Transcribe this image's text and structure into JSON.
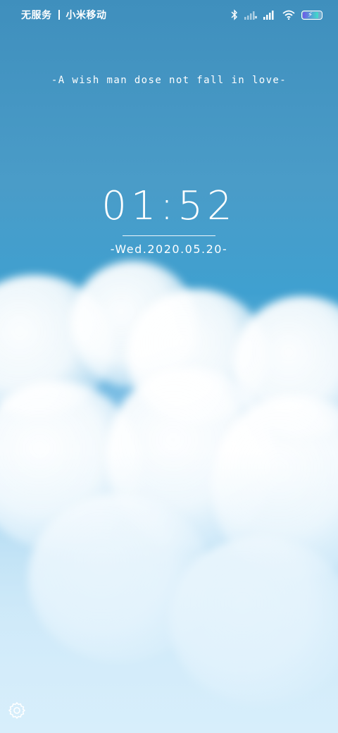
{
  "status_bar": {
    "carrier_1": "无服务",
    "carrier_2": "小米移动",
    "battery_level": 0.85,
    "icons": [
      "bluetooth-icon",
      "signal-weak-icon",
      "signal-icon",
      "wifi-icon",
      "battery-charging-icon"
    ]
  },
  "lock_screen": {
    "slogan": "-A wish man dose not fall in love-",
    "time": "01:52",
    "date": "-Wed.2020.05.20-"
  },
  "controls": {
    "settings_icon": "gear-icon"
  },
  "colors": {
    "sky_top": "#3f8fbd",
    "sky_mid": "#3fa0d0",
    "battery_start": "#6f58e8",
    "battery_end": "#3fe0c8"
  }
}
